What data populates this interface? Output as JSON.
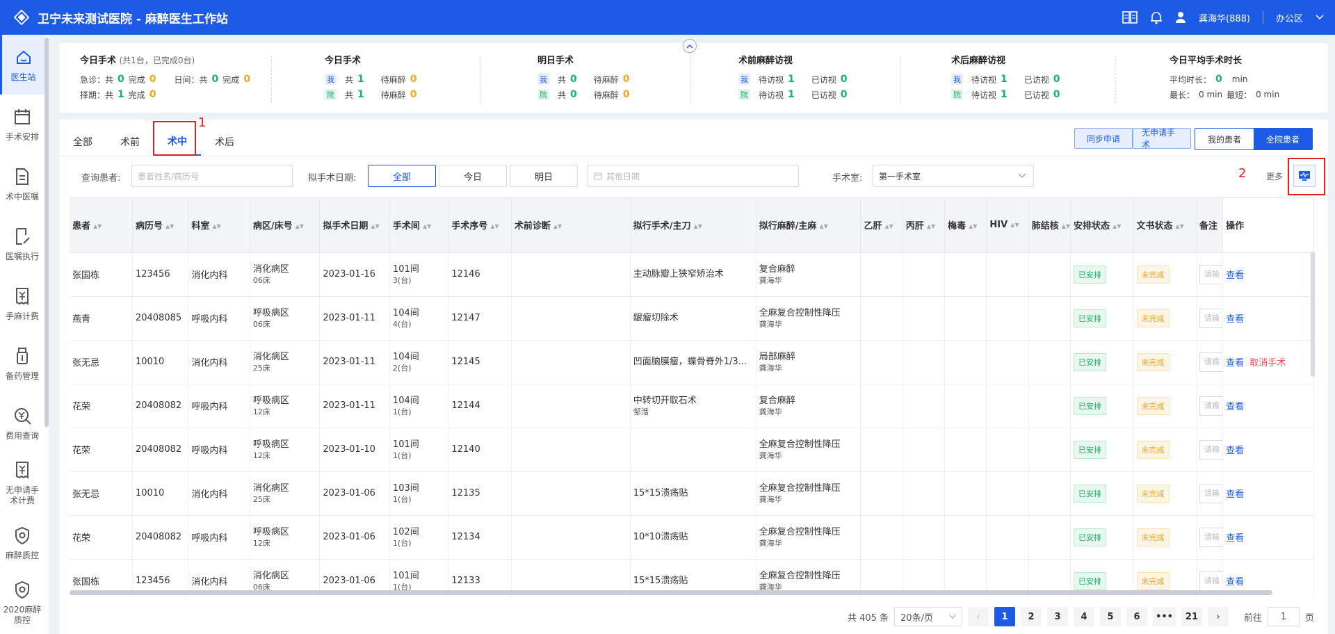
{
  "app": {
    "title": "卫宁未来测试医院 - 麻醉医生工作站",
    "user": "龚海华(888)",
    "location": "办公区"
  },
  "sidebar": [
    {
      "label": "医生站",
      "icon": "home-icon"
    },
    {
      "label": "手术安排",
      "icon": "calendar-icon"
    },
    {
      "label": "术中医嘱",
      "icon": "document-icon"
    },
    {
      "label": "医嘱执行",
      "icon": "edit-document-icon"
    },
    {
      "label": "手麻计费",
      "icon": "yuan-receipt-icon"
    },
    {
      "label": "备药管理",
      "icon": "medicine-bottle-icon"
    },
    {
      "label": "费用查询",
      "icon": "yuan-search-icon"
    },
    {
      "label": "无申请手术计费",
      "icon": "yuan-receipt-icon"
    },
    {
      "label": "麻醉质控",
      "icon": "shield-icon"
    },
    {
      "label": "2020麻醉质控",
      "icon": "shield-icon"
    }
  ],
  "stats": {
    "today": {
      "title": "今日手术",
      "sub": "(共1台，已完成0台)",
      "r1": [
        "急诊：共",
        "0",
        "完成",
        "0",
        "日间：共",
        "0",
        "完成",
        "0"
      ],
      "r2": [
        "择期：共",
        "1",
        "完成",
        "0"
      ]
    },
    "today_surgery": {
      "title": "今日手术",
      "me": [
        "我",
        "共",
        "1",
        "待麻醉",
        "0"
      ],
      "yuan": [
        "院",
        "共",
        "1",
        "待麻醉",
        "0"
      ]
    },
    "tomorrow": {
      "title": "明日手术",
      "me": [
        "我",
        "共",
        "0",
        "待麻醉",
        "0"
      ],
      "yuan": [
        "院",
        "共",
        "0",
        "待麻醉",
        "0"
      ]
    },
    "pre_visit": {
      "title": "术前麻醉访视",
      "me": [
        "我",
        "待访视",
        "1",
        "已访视",
        "0"
      ],
      "yuan": [
        "院",
        "待访视",
        "1",
        "已访视",
        "0"
      ]
    },
    "post_visit": {
      "title": "术后麻醉访视",
      "me": [
        "我",
        "待访视",
        "1",
        "已访视",
        "0"
      ],
      "yuan": [
        "院",
        "待访视",
        "1",
        "已访视",
        "0"
      ]
    },
    "avg": {
      "title": "今日平均手术时长",
      "avg_label": "平均时长：",
      "avg_val": "0",
      "avg_unit": "min",
      "max_label": "最长：",
      "max_val": "0 min",
      "min_label": "最短：",
      "min_val": "0 min"
    }
  },
  "tabs": [
    "全部",
    "术前",
    "术中",
    "术后"
  ],
  "active_tab": 2,
  "annotations": {
    "a1": "1",
    "a2": "2"
  },
  "buttons": {
    "sync": "同步申请",
    "no_apply": "无申请手术",
    "my_patients": "我的患者",
    "all_patients": "全院患者"
  },
  "filters": {
    "patient_label": "查询患者:",
    "patient_placeholder": "患者姓名/病历号",
    "date_label": "拟手术日期:",
    "date_all": "全部",
    "date_today": "今日",
    "date_tomorrow": "明日",
    "date_other": "其他日期",
    "room_label": "手术室:",
    "room_value": "第一手术室",
    "more": "更多"
  },
  "table": {
    "headers": [
      "患者",
      "病历号",
      "科室",
      "病区/床号",
      "拟手术日期",
      "手术间",
      "手术序号",
      "术前诊断",
      "拟行手术/主刀",
      "拟行麻醉/主麻",
      "乙肝",
      "丙肝",
      "梅毒",
      "HIV",
      "肺结核",
      "安排状态",
      "文书状态",
      "备注",
      "操作"
    ],
    "rows": [
      {
        "name": "张国栋",
        "mrn": "123456",
        "dept": "消化内科",
        "ward": "消化病区",
        "bed": "06床",
        "date": "2023-01-16",
        "room": "101间",
        "tai": "3(台)",
        "seq": "12146",
        "diag": "",
        "op": "主动脉瓣上狭窄矫治术",
        "surgeon": "",
        "anes": "复合麻醉",
        "anesthetist": "龚海华",
        "arrange": "已安排",
        "doc": "未完成",
        "note": "请输",
        "view": "查看",
        "cancel": ""
      },
      {
        "name": "燕青",
        "mrn": "20408085",
        "dept": "呼吸内科",
        "ward": "呼吸病区",
        "bed": "06床",
        "date": "2023-01-11",
        "room": "104间",
        "tai": "4(台)",
        "seq": "12147",
        "diag": "",
        "op": "龈瘤切除术",
        "surgeon": "",
        "anes": "全麻复合控制性降压",
        "anesthetist": "龚海华",
        "arrange": "已安排",
        "doc": "未完成",
        "note": "请输",
        "view": "查看",
        "cancel": ""
      },
      {
        "name": "张无忌",
        "mrn": "10010",
        "dept": "消化内科",
        "ward": "消化病区",
        "bed": "25床",
        "date": "2023-01-11",
        "room": "104间",
        "tai": "2(台)",
        "seq": "12145",
        "diag": "",
        "op": "凹面脑膜瘤，蝶骨脊外1/3...",
        "surgeon": "",
        "anes": "局部麻醉",
        "anesthetist": "龚海华",
        "arrange": "已安排",
        "doc": "未完成",
        "note": "请输",
        "view": "查看",
        "cancel": "取消手术"
      },
      {
        "name": "花荣",
        "mrn": "20408082",
        "dept": "呼吸内科",
        "ward": "呼吸病区",
        "bed": "12床",
        "date": "2023-01-11",
        "room": "104间",
        "tai": "1(台)",
        "seq": "12144",
        "diag": "",
        "op": "中转切开取石术",
        "surgeon": "邹湉",
        "anes": "复合麻醉",
        "anesthetist": "龚海华",
        "arrange": "已安排",
        "doc": "未完成",
        "note": "请输",
        "view": "查看",
        "cancel": ""
      },
      {
        "name": "花荣",
        "mrn": "20408082",
        "dept": "呼吸内科",
        "ward": "呼吸病区",
        "bed": "12床",
        "date": "2023-01-10",
        "room": "101间",
        "tai": "1(台)",
        "seq": "12140",
        "diag": "",
        "op": "",
        "surgeon": "",
        "anes": "全麻复合控制性降压",
        "anesthetist": "龚海华",
        "arrange": "已安排",
        "doc": "未完成",
        "note": "请输",
        "view": "查看",
        "cancel": ""
      },
      {
        "name": "张无忌",
        "mrn": "10010",
        "dept": "消化内科",
        "ward": "消化病区",
        "bed": "25床",
        "date": "2023-01-06",
        "room": "103间",
        "tai": "1(台)",
        "seq": "12135",
        "diag": "",
        "op": "15*15溃疡贴",
        "surgeon": "",
        "anes": "全麻复合控制性降压",
        "anesthetist": "龚海华",
        "arrange": "已安排",
        "doc": "未完成",
        "note": "请输",
        "view": "查看",
        "cancel": ""
      },
      {
        "name": "花荣",
        "mrn": "20408082",
        "dept": "呼吸内科",
        "ward": "呼吸病区",
        "bed": "12床",
        "date": "2023-01-06",
        "room": "102间",
        "tai": "1(台)",
        "seq": "12134",
        "diag": "",
        "op": "10*10溃疡贴",
        "surgeon": "",
        "anes": "全麻复合控制性降压",
        "anesthetist": "龚海华",
        "arrange": "已安排",
        "doc": "未完成",
        "note": "请输",
        "view": "查看",
        "cancel": ""
      },
      {
        "name": "张国栋",
        "mrn": "123456",
        "dept": "消化内科",
        "ward": "消化病区",
        "bed": "06床",
        "date": "2023-01-06",
        "room": "101间",
        "tai": "1(台)",
        "seq": "12133",
        "diag": "",
        "op": "15*15溃疡贴",
        "surgeon": "",
        "anes": "全麻复合控制性降压",
        "anesthetist": "龚海华",
        "arrange": "已安排",
        "doc": "未完成",
        "note": "请输",
        "view": "查看",
        "cancel": ""
      }
    ]
  },
  "pagination": {
    "total": "共 405 条",
    "page_size": "20条/页",
    "pages": [
      "1",
      "2",
      "3",
      "4",
      "5",
      "6",
      "•••",
      "21"
    ],
    "current": "1",
    "goto_label": "前往",
    "goto_value": "1",
    "goto_unit": "页"
  },
  "colors": {
    "primary": "#1d5be6",
    "success": "#17b26a",
    "warning": "#f5a623",
    "danger": "#ff4d4f",
    "annotation": "#e02020"
  }
}
